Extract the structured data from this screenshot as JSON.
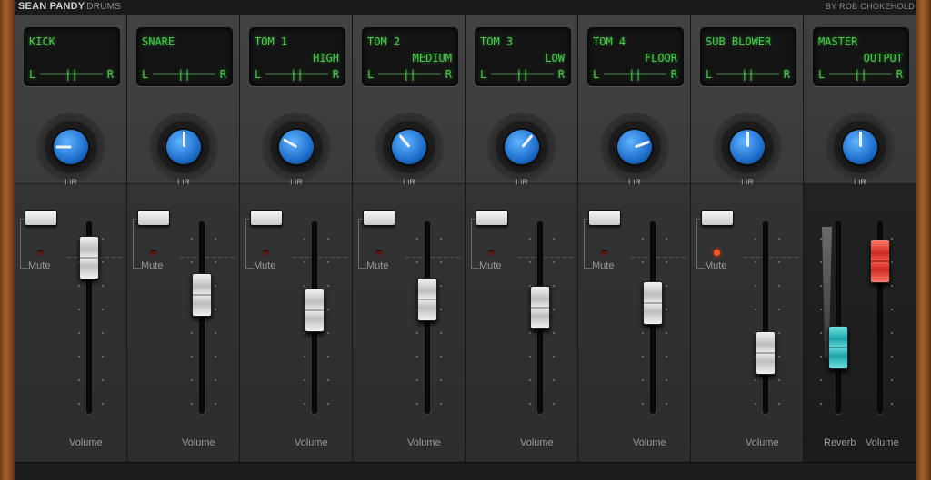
{
  "app": {
    "title": "SEAN PANDY",
    "subtitle": "DRUMS",
    "credit": "BY ROB CHOKEHOLD"
  },
  "pan_labels": {
    "left": "L",
    "right": "R"
  },
  "mute_label": "Mute",
  "volume_label": "Volume",
  "reverb_label": "Reverb",
  "colors": {
    "lcd_text": "#47c94a",
    "knob": "#1f6fcc",
    "fader_teal": "#1ca3a8",
    "fader_red": "#cc2a20",
    "mute_led_on": "#ff5522",
    "wood": "#8a4d22"
  },
  "channels": [
    {
      "line1": "KICK",
      "line2": "",
      "pan": -90,
      "volume": 0.9,
      "muted": false
    },
    {
      "line1": "SNARE",
      "line2": "",
      "pan": 0,
      "volume": 0.65,
      "muted": false
    },
    {
      "line1": "TOM 1",
      "line2": "HIGH",
      "pan": -60,
      "volume": 0.55,
      "muted": false
    },
    {
      "line1": "TOM 2",
      "line2": "MEDIUM",
      "pan": -40,
      "volume": 0.62,
      "muted": false
    },
    {
      "line1": "TOM 3",
      "line2": "LOW",
      "pan": 40,
      "volume": 0.57,
      "muted": false
    },
    {
      "line1": "TOM 4",
      "line2": "FLOOR",
      "pan": 70,
      "volume": 0.6,
      "muted": false
    },
    {
      "line1": "SUB BLOWER",
      "line2": "",
      "pan": 0,
      "volume": 0.26,
      "muted": true
    }
  ],
  "master": {
    "line1": "MASTER",
    "line2": "OUTPUT",
    "pan": 0,
    "reverb": 0.3,
    "volume": 0.88
  }
}
